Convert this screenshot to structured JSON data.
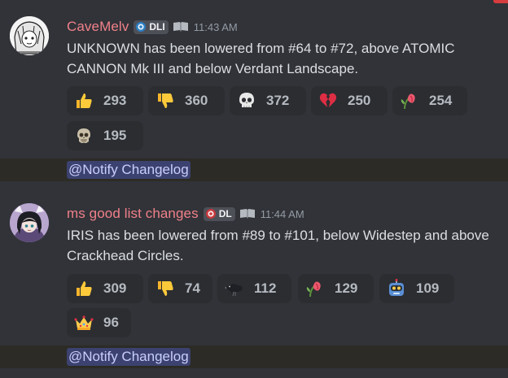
{
  "messages": [
    {
      "username": "CaveMelv",
      "tag": "DLI",
      "time": "11:43 AM",
      "text": "UNKNOWN has been lowered from #64 to #72, above ATOMIC CANNON Mk III and below Verdant Landscape.",
      "reactions": [
        {
          "emoji": "thumbs-up-icon",
          "count": "293"
        },
        {
          "emoji": "thumbs-down-icon",
          "count": "360"
        },
        {
          "emoji": "skull-icon",
          "count": "372"
        },
        {
          "emoji": "broken-heart-icon",
          "count": "250"
        },
        {
          "emoji": "wilted-flower-icon",
          "count": "254"
        },
        {
          "emoji": "skull-face-icon",
          "count": "195"
        }
      ],
      "mention": "@Notify Changelog"
    },
    {
      "username": "ms good list changes",
      "tag": "DL",
      "time": "11:44 AM",
      "text": "IRIS has been lowered from #89 to #101, below Widestep and above Crackhead Circles.",
      "reactions": [
        {
          "emoji": "thumbs-up-icon",
          "count": "309"
        },
        {
          "emoji": "thumbs-down-icon",
          "count": "74"
        },
        {
          "emoji": "crow-icon",
          "count": "112"
        },
        {
          "emoji": "wilted-flower-icon",
          "count": "129"
        },
        {
          "emoji": "robot-icon",
          "count": "109"
        },
        {
          "emoji": "crown-icon",
          "count": "96"
        }
      ],
      "mention": "@Notify Changelog"
    }
  ],
  "colors": {
    "background": "#313338",
    "username": "#f0808a",
    "mention_bg": "#3c4270",
    "mention_text": "#c9cdfb",
    "reaction_bg": "#2b2d31"
  }
}
